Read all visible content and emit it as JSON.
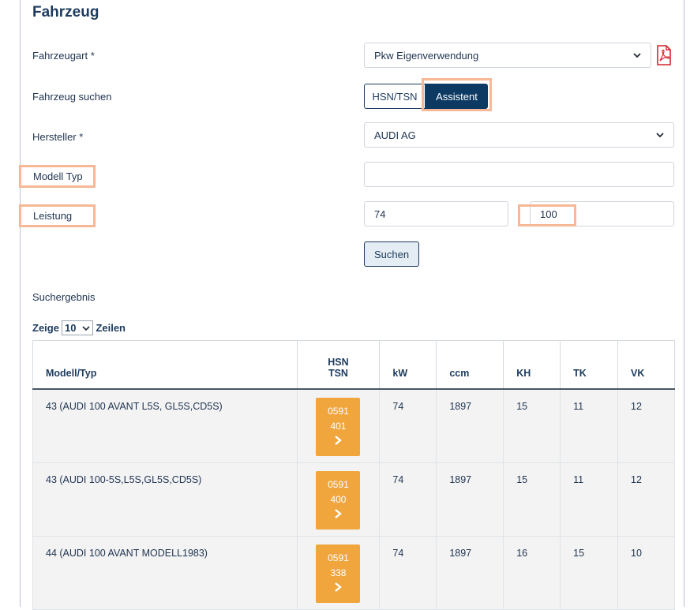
{
  "section": {
    "title": "Fahrzeug"
  },
  "form": {
    "fahrzeugart": {
      "label": "Fahrzeugart *",
      "value": "Pkw Eigenverwendung"
    },
    "fahrzeug_suchen": {
      "label": "Fahrzeug suchen",
      "options": [
        "HSN/TSN",
        "Assistent"
      ],
      "active": "Assistent"
    },
    "hersteller": {
      "label": "Hersteller *",
      "value": "AUDI AG"
    },
    "modell_typ": {
      "label": "Modell Typ",
      "value": ""
    },
    "leistung": {
      "label": "Leistung",
      "from": "74",
      "to": "100"
    },
    "search_button": "Suchen"
  },
  "results": {
    "title": "Suchergebnis",
    "paging": {
      "prefix": "Zeige",
      "value": "10",
      "suffix": "Zeilen"
    },
    "columns": [
      "Modell/Typ",
      "HSN",
      "TSN",
      "kW",
      "ccm",
      "KH",
      "TK",
      "VK"
    ],
    "rows": [
      {
        "model": "43 (AUDI 100 AVANT L5S, GL5S,CD5S)",
        "hsn": "0591",
        "tsn": "401",
        "kw": "74",
        "ccm": "1897",
        "kh": "15",
        "tk": "11",
        "vk": "12"
      },
      {
        "model": "43 (AUDI 100-5S,L5S,GL5S,CD5S)",
        "hsn": "0591",
        "tsn": "400",
        "kw": "74",
        "ccm": "1897",
        "kh": "15",
        "tk": "11",
        "vk": "12"
      },
      {
        "model": "44 (AUDI 100 AVANT MODELL1983)",
        "hsn": "0591",
        "tsn": "338",
        "kw": "74",
        "ccm": "1897",
        "kh": "16",
        "tk": "15",
        "vk": "10"
      }
    ]
  },
  "icons": {
    "pdf": "pdf-icon",
    "dropdown": "chevron-down-icon",
    "row_action": "chevron-right-icon"
  },
  "colors": {
    "primary": "#0c3a62",
    "badge": "#f0a63c",
    "highlight": "#f6b896",
    "pdf": "#d6262e"
  }
}
